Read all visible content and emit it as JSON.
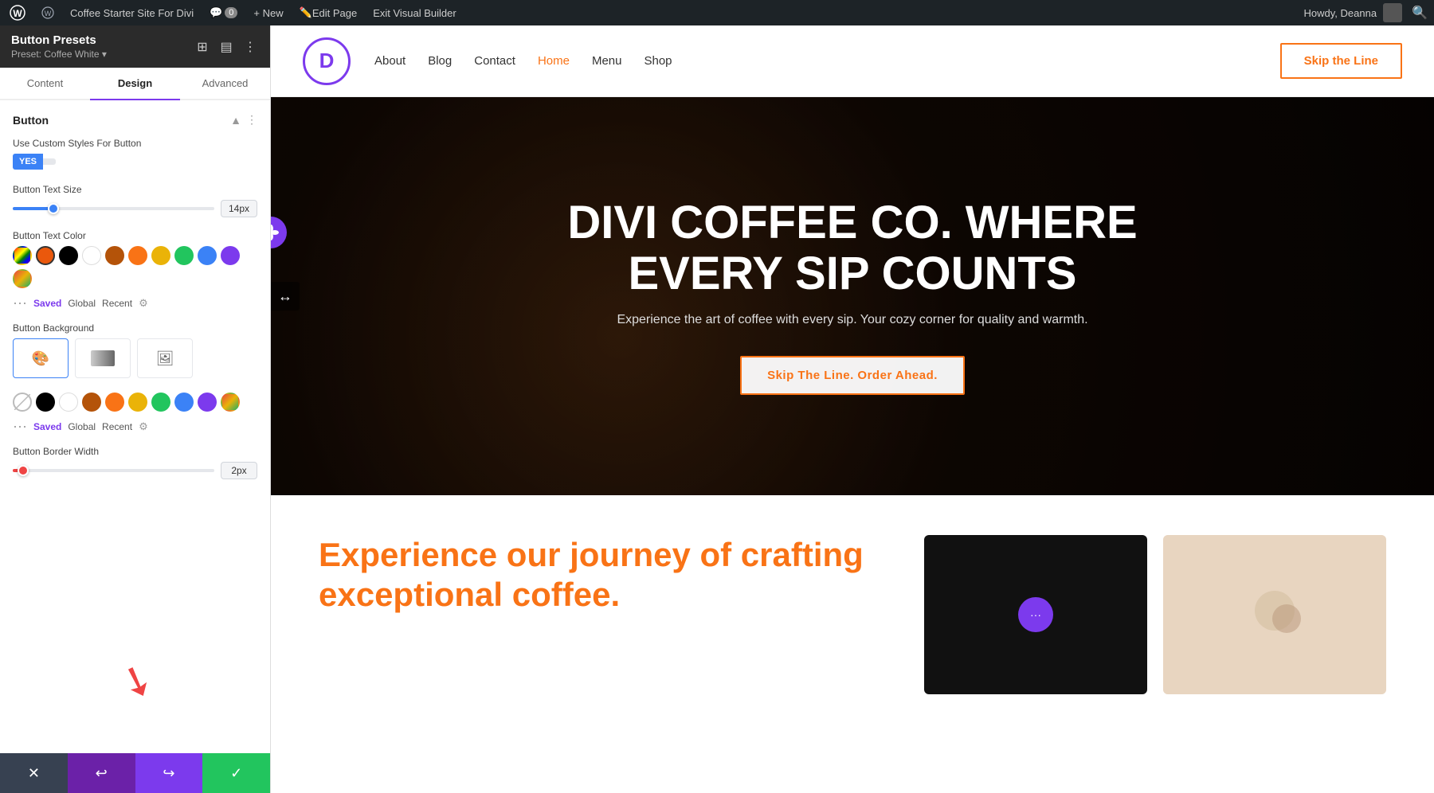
{
  "adminBar": {
    "wpLogo": "⊕",
    "siteName": "Coffee Starter Site For Divi",
    "commentIcon": "💬",
    "commentCount": "0",
    "newLabel": "+ New",
    "editPageLabel": "Edit Page",
    "exitBuilder": "Exit Visual Builder",
    "howdyLabel": "Howdy, Deanna"
  },
  "panel": {
    "title": "Button Presets",
    "preset": "Preset: Coffee White ▾",
    "tabs": [
      {
        "id": "content",
        "label": "Content"
      },
      {
        "id": "design",
        "label": "Design"
      },
      {
        "id": "advanced",
        "label": "Advanced"
      }
    ],
    "activeTab": "design",
    "section": {
      "title": "Button",
      "toggleLabel": "Use Custom Styles For Button",
      "toggleYes": "YES",
      "toggleNo": "",
      "textSizeLabel": "Button Text Size",
      "textSizeValue": "14px",
      "textSizeSliderPct": 20,
      "textColorLabel": "Button Text Color",
      "colorSwatches": [
        {
          "color": "#ea580c",
          "id": "orange",
          "active": true
        },
        {
          "color": "#000000",
          "id": "black"
        },
        {
          "color": "#ffffff",
          "id": "white"
        },
        {
          "color": "#b45309",
          "id": "brown"
        },
        {
          "color": "#f97316",
          "id": "orange2"
        },
        {
          "color": "#eab308",
          "id": "yellow"
        },
        {
          "color": "#22c55e",
          "id": "green"
        },
        {
          "color": "#3b82f6",
          "id": "blue"
        },
        {
          "color": "#7c3aed",
          "id": "purple"
        },
        {
          "color": "picker",
          "id": "picker"
        }
      ],
      "colorMetaSaved": "Saved",
      "colorMetaGlobal": "Global",
      "colorMetaRecent": "Recent",
      "bgLabel": "Button Background",
      "bgOptions": [
        {
          "id": "solid",
          "icon": "🎨",
          "active": true
        },
        {
          "id": "gradient",
          "icon": "▦"
        },
        {
          "id": "image",
          "icon": "🖼"
        }
      ],
      "colorSwatches2": [
        {
          "color": "transparent",
          "id": "trans",
          "active": true
        },
        {
          "color": "#000000",
          "id": "black2"
        },
        {
          "color": "#ffffff",
          "id": "white2"
        },
        {
          "color": "#b45309",
          "id": "brown2"
        },
        {
          "color": "#f97316",
          "id": "orange3"
        },
        {
          "color": "#eab308",
          "id": "yellow2"
        },
        {
          "color": "#22c55e",
          "id": "green2"
        },
        {
          "color": "#3b82f6",
          "id": "blue2"
        },
        {
          "color": "#7c3aed",
          "id": "purple2"
        },
        {
          "color": "picker",
          "id": "picker2"
        }
      ],
      "colorMeta2Saved": "Saved",
      "colorMeta2Global": "Global",
      "colorMeta2Recent": "Recent",
      "borderWidthLabel": "Button Border Width",
      "borderWidthValue": "2px",
      "borderWidthSliderPct": 5
    }
  },
  "bottomBar": {
    "cancelIcon": "✕",
    "undoIcon": "↩",
    "redoIcon": "↪",
    "saveIcon": "✓"
  },
  "siteNav": {
    "logoLetter": "D",
    "links": [
      {
        "id": "about",
        "label": "About"
      },
      {
        "id": "blog",
        "label": "Blog"
      },
      {
        "id": "contact",
        "label": "Contact"
      },
      {
        "id": "home",
        "label": "Home",
        "active": true
      },
      {
        "id": "menu",
        "label": "Menu"
      },
      {
        "id": "shop",
        "label": "Shop"
      }
    ],
    "skipBtn": "Skip the Line"
  },
  "hero": {
    "title": "DIVI COFFEE CO. WHERE EVERY SIP COUNTS",
    "subtitle": "Experience the art of coffee with every sip. Your cozy corner for quality and warmth.",
    "ctaLabel": "Skip The Line. Order Ahead."
  },
  "belowHero": {
    "heading": "Experience our journey of crafting exceptional coffee.",
    "card1Alt": "dark coffee card",
    "card2Alt": "light coffee card"
  }
}
